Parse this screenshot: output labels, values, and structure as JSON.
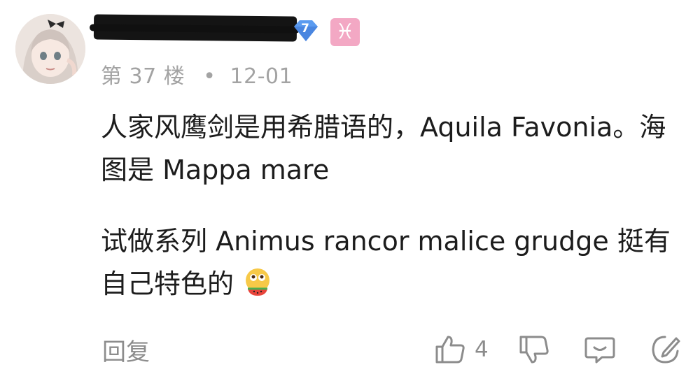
{
  "post": {
    "floor": "第 37 楼",
    "separator": "•",
    "date": "12-01",
    "level": "7",
    "zodiac_glyph": "♓",
    "content": {
      "paragraph1": "人家风鹰剑是用希腊语的，Aquila Favonia。海图是 Mappa mare",
      "paragraph2": "试做系列 Animus rancor malice grudge 挺有自己特色的"
    },
    "emoji_icon": "eating-watermelon-emoji-icon"
  },
  "actions": {
    "reply_label": "回复",
    "like_count": "4"
  },
  "colors": {
    "meta_text": "#a3a3a3",
    "level_badge": "#5b9bf0",
    "zodiac_badge": "#f3a8c4",
    "action_icon": "#8c8c8c"
  }
}
